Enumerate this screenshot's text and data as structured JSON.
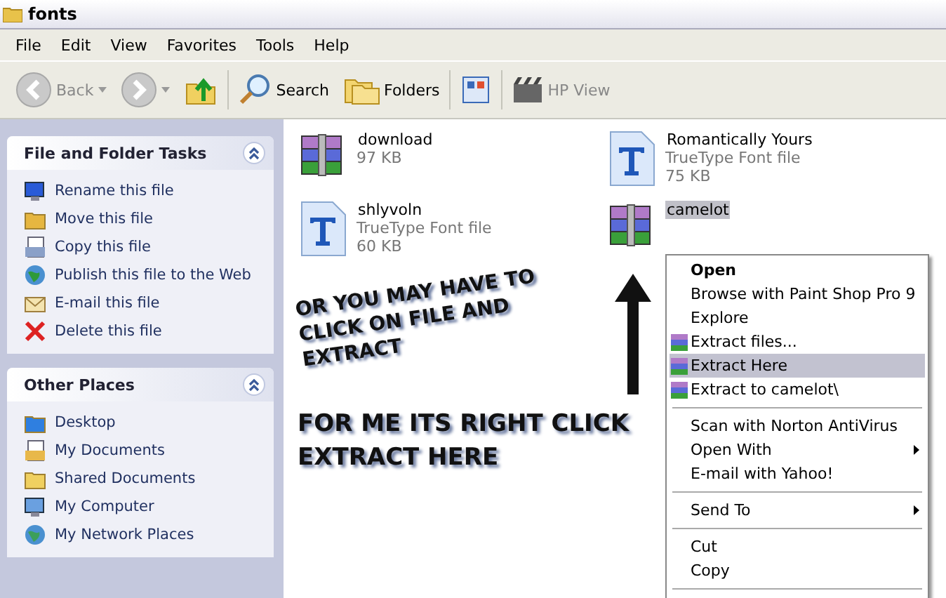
{
  "window": {
    "title": "fonts"
  },
  "menu_bar": [
    "File",
    "Edit",
    "View",
    "Favorites",
    "Tools",
    "Help"
  ],
  "toolbar": [
    {
      "kind": "back",
      "label": "Back"
    },
    {
      "kind": "forward"
    },
    {
      "kind": "up"
    },
    {
      "kind": "search",
      "label": "Search"
    },
    {
      "kind": "folders",
      "label": "Folders"
    },
    {
      "kind": "views"
    },
    {
      "kind": "hpview",
      "label": "HP View"
    }
  ],
  "task_panes": [
    {
      "title": "File and Folder Tasks",
      "items": [
        {
          "kind": "rename",
          "label": "Rename this file"
        },
        {
          "kind": "move",
          "label": "Move this file"
        },
        {
          "kind": "copy",
          "label": "Copy this file"
        },
        {
          "kind": "publish",
          "label": "Publish this file to the Web"
        },
        {
          "kind": "email",
          "label": "E-mail this file"
        },
        {
          "kind": "delete",
          "label": "Delete this file"
        }
      ]
    },
    {
      "title": "Other Places",
      "items": [
        {
          "kind": "desktop",
          "label": "Desktop"
        },
        {
          "kind": "documents",
          "label": "My Documents"
        },
        {
          "kind": "folder",
          "label": "Shared Documents"
        },
        {
          "kind": "computer",
          "label": "My Computer"
        },
        {
          "kind": "network",
          "label": "My Network Places"
        }
      ]
    }
  ],
  "files": [
    {
      "kind": "archive",
      "name": "download",
      "size": "97 KB",
      "selected": false
    },
    {
      "kind": "font",
      "name": "Romantically Yours",
      "type": "TrueType Font file",
      "size": "75 KB",
      "selected": false
    },
    {
      "kind": "font",
      "name": "shlyvoln",
      "type": "TrueType Font file",
      "size": "60 KB",
      "selected": false
    },
    {
      "kind": "archive",
      "name": "camelot",
      "selected": true
    }
  ],
  "context_menu": [
    {
      "kind": "default",
      "label": "Open",
      "selected": false
    },
    {
      "kind": "plain",
      "label": "Browse with Paint Shop Pro 9",
      "selected": false
    },
    {
      "kind": "plain",
      "label": "Explore",
      "selected": false
    },
    {
      "kind": "archive",
      "label": "Extract files...",
      "selected": false
    },
    {
      "kind": "archive",
      "label": "Extract Here",
      "selected": true
    },
    {
      "kind": "archive",
      "label": "Extract to camelot\\",
      "selected": false
    },
    {
      "kind": "separator"
    },
    {
      "kind": "plain",
      "label": "Scan with Norton AntiVirus",
      "selected": false
    },
    {
      "kind": "submenu",
      "label": "Open With",
      "selected": false
    },
    {
      "kind": "plain",
      "label": "E-mail with Yahoo!",
      "selected": false
    },
    {
      "kind": "separator"
    },
    {
      "kind": "submenu",
      "label": "Send To",
      "selected": false
    },
    {
      "kind": "separator"
    },
    {
      "kind": "plain",
      "label": "Cut",
      "selected": false
    },
    {
      "kind": "plain",
      "label": "Copy",
      "selected": false
    },
    {
      "kind": "separator"
    }
  ],
  "annotations": [
    "OR YOU MAY HAVE TO CLICK ON FILE AND EXTRACT",
    "FOR ME ITS RIGHT CLICK EXTRACT HERE"
  ]
}
